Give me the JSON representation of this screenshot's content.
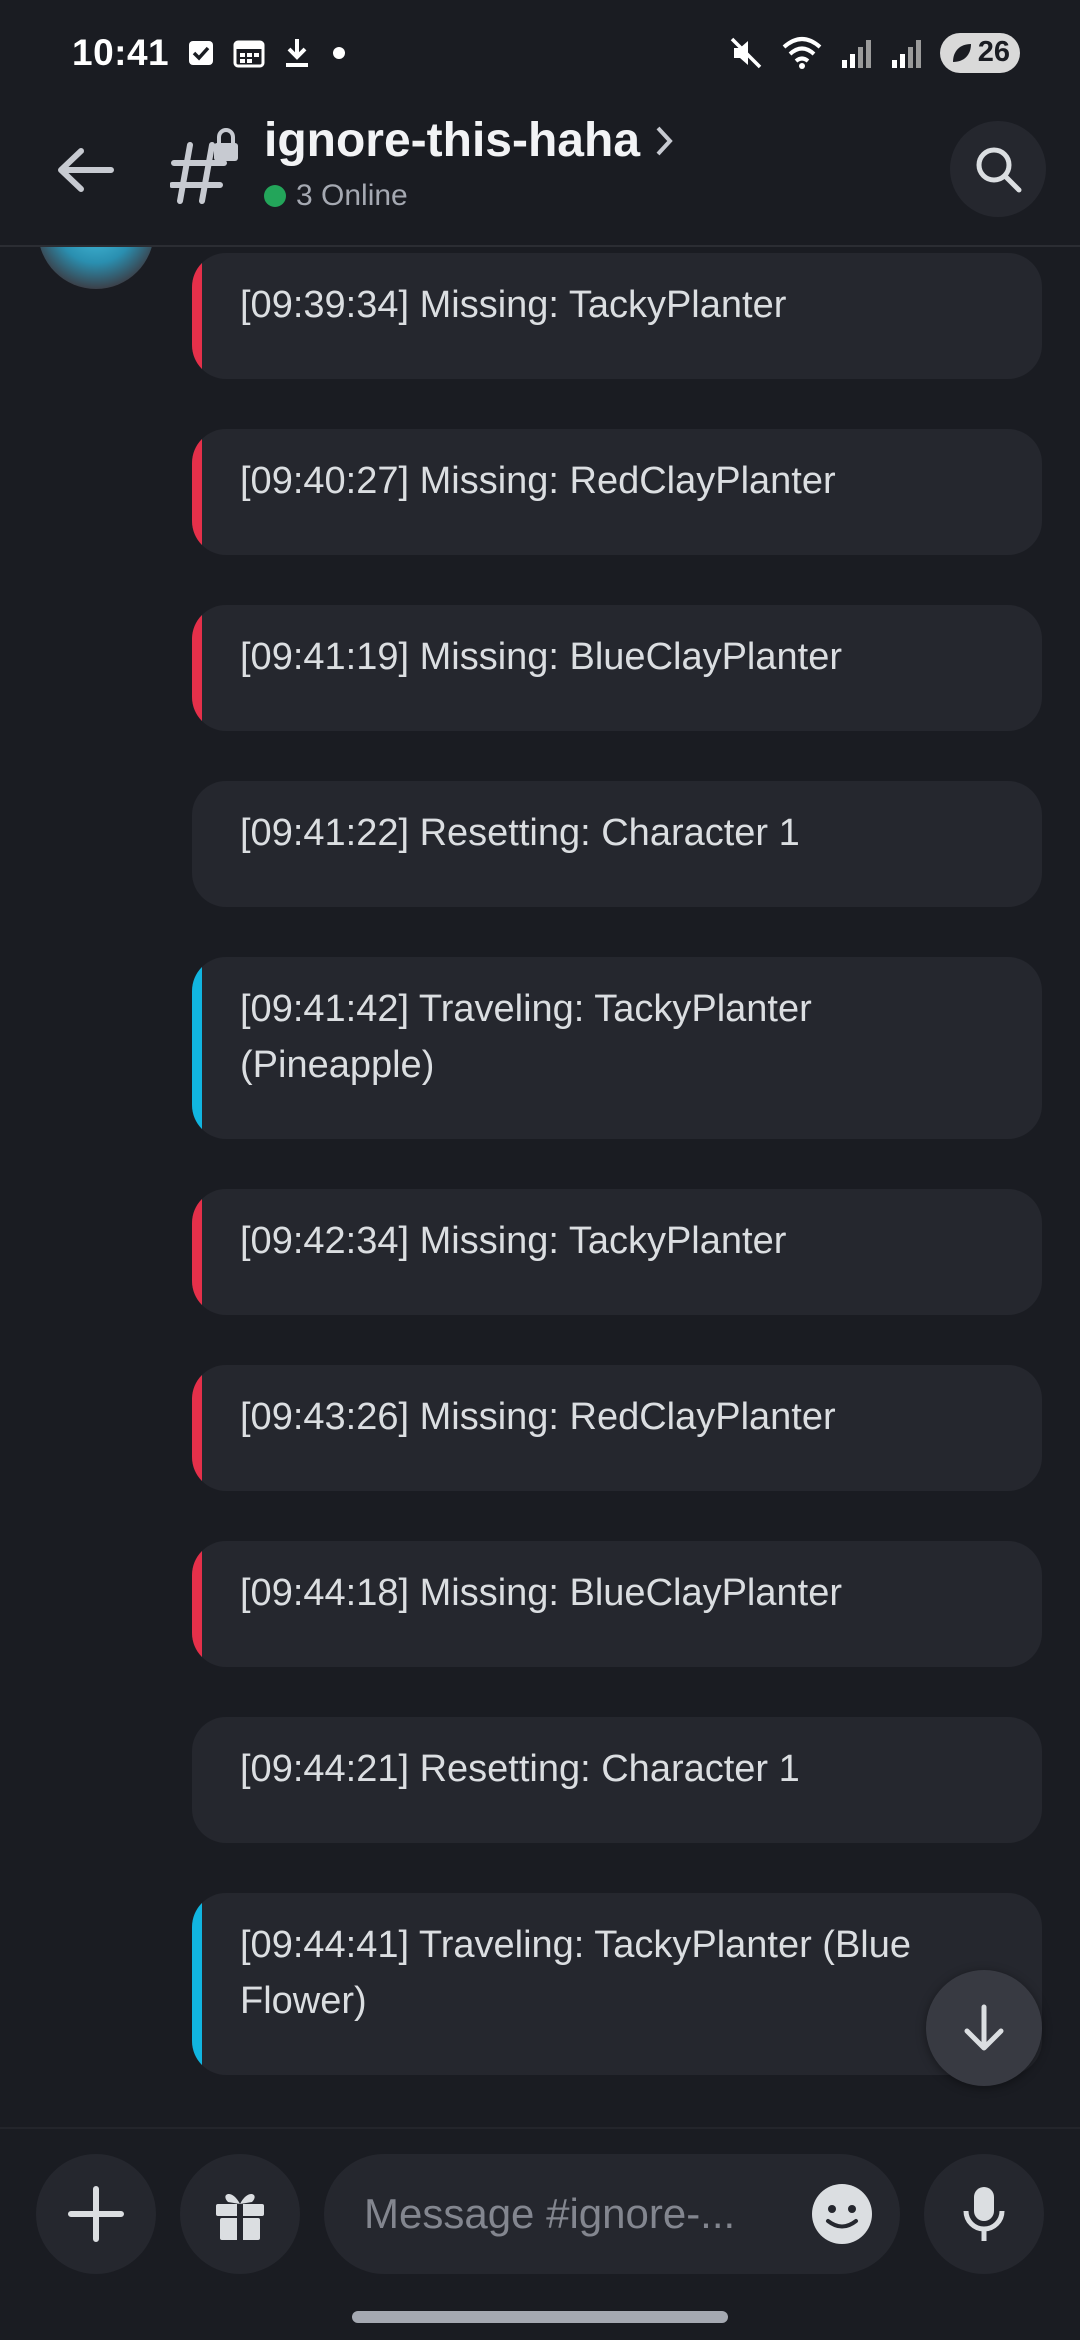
{
  "status_bar": {
    "time": "10:41",
    "battery": "26",
    "left_icons": [
      "checkbox-icon",
      "calendar-icon",
      "download-icon",
      "dot-icon"
    ],
    "right_icons": [
      "mute-icon",
      "wifi-icon",
      "signal-icon",
      "signal-icon"
    ]
  },
  "header": {
    "channel_name": "ignore-this-haha",
    "online_text": "3 Online",
    "online_color": "#23a55a"
  },
  "messages": [
    {
      "text": "[09:39:34] Missing: TackyPlanter",
      "accent": "#e5304a"
    },
    {
      "text": "[09:40:27] Missing: RedClayPlanter",
      "accent": "#e5304a"
    },
    {
      "text": "[09:41:19] Missing: BlueClayPlanter",
      "accent": "#e5304a"
    },
    {
      "text": "[09:41:22] Resetting: Character 1",
      "accent": ""
    },
    {
      "text": "[09:41:42] Traveling: TackyPlanter (Pineapple)",
      "accent": "#11b5e0"
    },
    {
      "text": "[09:42:34] Missing: TackyPlanter",
      "accent": "#e5304a"
    },
    {
      "text": "[09:43:26] Missing: RedClayPlanter",
      "accent": "#e5304a"
    },
    {
      "text": "[09:44:18] Missing: BlueClayPlanter",
      "accent": "#e5304a"
    },
    {
      "text": "[09:44:21] Resetting: Character 1",
      "accent": ""
    },
    {
      "text": "[09:44:41] Traveling: TackyPlanter (Blue Flower)",
      "accent": "#11b5e0"
    }
  ],
  "composer": {
    "placeholder": "Message #ignore-..."
  }
}
